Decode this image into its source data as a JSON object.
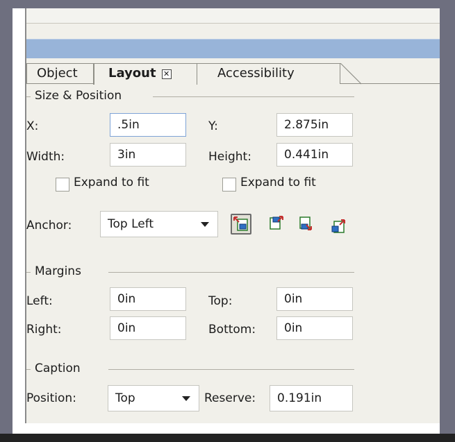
{
  "tabs": [
    {
      "label": "Object"
    },
    {
      "label": "Layout"
    },
    {
      "label": "Accessibility"
    }
  ],
  "size_position": {
    "section": "Size & Position",
    "x_label": "X:",
    "x_value": ".5in",
    "y_label": "Y:",
    "y_value": "2.875in",
    "width_label": "Width:",
    "width_value": "3in",
    "height_label": "Height:",
    "height_value": "0.441in",
    "expand_width": "Expand to fit",
    "expand_height": "Expand to fit",
    "anchor_label": "Anchor:",
    "anchor_value": "Top Left"
  },
  "margins": {
    "section": "Margins",
    "left_label": "Left:",
    "left_value": "0in",
    "top_label": "Top:",
    "top_value": "0in",
    "right_label": "Right:",
    "right_value": "0in",
    "bottom_label": "Bottom:",
    "bottom_value": "0in"
  },
  "caption": {
    "section": "Caption",
    "position_label": "Position:",
    "position_value": "Top",
    "reserve_label": "Reserve:",
    "reserve_value": "0.191in"
  },
  "colors": {
    "title_bar": "#98b4d9",
    "panel": "#f1f0ea",
    "frame": "#6e6f7f"
  },
  "icons": [
    "close-tab-icon",
    "anchor-top-left-icon",
    "anchor-top-right-icon",
    "anchor-bottom-left-icon",
    "anchor-bottom-right-icon",
    "dropdown-arrow-icon"
  ]
}
